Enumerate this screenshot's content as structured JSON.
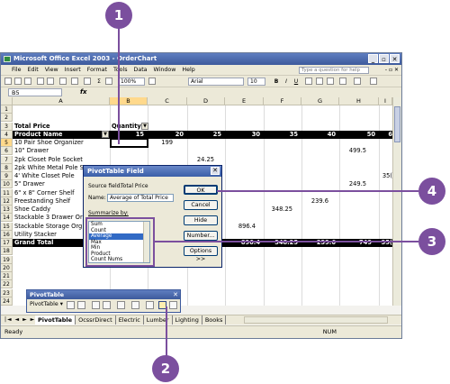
{
  "window": {
    "title": "Microsoft Office Excel 2003 - OrderChart"
  },
  "menu": [
    "File",
    "Edit",
    "View",
    "Insert",
    "Format",
    "Tools",
    "Data",
    "Window",
    "Help"
  ],
  "help_box_placeholder": "Type a question for help",
  "toolbar": {
    "zoom": "100%",
    "font": "Arial",
    "font_size": "10",
    "bold": "B",
    "italic": "I",
    "underline": "U"
  },
  "formula_bar": {
    "name_box": "B5",
    "fx": "fx"
  },
  "columns": [
    "A",
    "B",
    "C",
    "D",
    "E",
    "F",
    "G",
    "H",
    "I"
  ],
  "rows": [
    "1",
    "2",
    "3",
    "4",
    "5",
    "6",
    "7",
    "8",
    "9",
    "10",
    "11",
    "12",
    "13",
    "14",
    "15",
    "16",
    "17",
    "18",
    "19",
    "20",
    "21",
    "22",
    "23",
    "24"
  ],
  "sheet": {
    "total_price_label": "Total Price",
    "quantity_label": "Quantity",
    "product_name_label": "Product Name",
    "quantities": [
      "15",
      "20",
      "25",
      "30",
      "35",
      "40",
      "50",
      "6"
    ],
    "products": [
      "10 Pair Shoe Organizer",
      "10\" Drawer",
      "2pk Closet Pole Socket",
      "2pk White Metal Pole S",
      "4' White Closet Pole",
      "5\" Drawer",
      "6\" x 8\" Corner Shelf",
      "Freestanding Shelf",
      "Shoe Caddy",
      "Stackable 3 Drawer Or",
      "Stackable Storage Org",
      "Utility Stacker"
    ],
    "values": {
      "c5": "199",
      "h6": "499.5",
      "d7": "24.25",
      "i9": "35(",
      "h10": "249.5",
      "g12": "239.6",
      "f13": "348.25",
      "e15": "896.4"
    },
    "grand_total_label": "Grand Total",
    "grand_totals": [
      "896.4",
      "348.25",
      "239.6",
      "749",
      "35("
    ]
  },
  "dialog": {
    "title": "PivotTable Field",
    "source_field_label": "Source field:",
    "source_field_value": "Total Price",
    "name_label": "Name:",
    "name_value": "Average of Total Price",
    "summarize_label": "Summarize by:",
    "summarize_options": [
      "Sum",
      "Count",
      "Average",
      "Max",
      "Min",
      "Product",
      "Count Nums"
    ],
    "selected_option": "Average",
    "buttons": {
      "ok": "OK",
      "cancel": "Cancel",
      "hide": "Hide",
      "number": "Number...",
      "options": "Options >>"
    }
  },
  "pivot_toolbar": {
    "title": "PivotTable",
    "menu_label": "PivotTable ▾"
  },
  "sheet_tabs": [
    "PivotTable",
    "OcssrDirect",
    "Electric",
    "Lumber",
    "Lighting",
    "Books"
  ],
  "status": {
    "ready": "Ready",
    "num": "NUM"
  },
  "callouts": [
    "1",
    "2",
    "3",
    "4"
  ],
  "colors": {
    "callout": "#7b4f9e",
    "title_bar": "#3d5a9c",
    "selection": "#316ac5"
  }
}
